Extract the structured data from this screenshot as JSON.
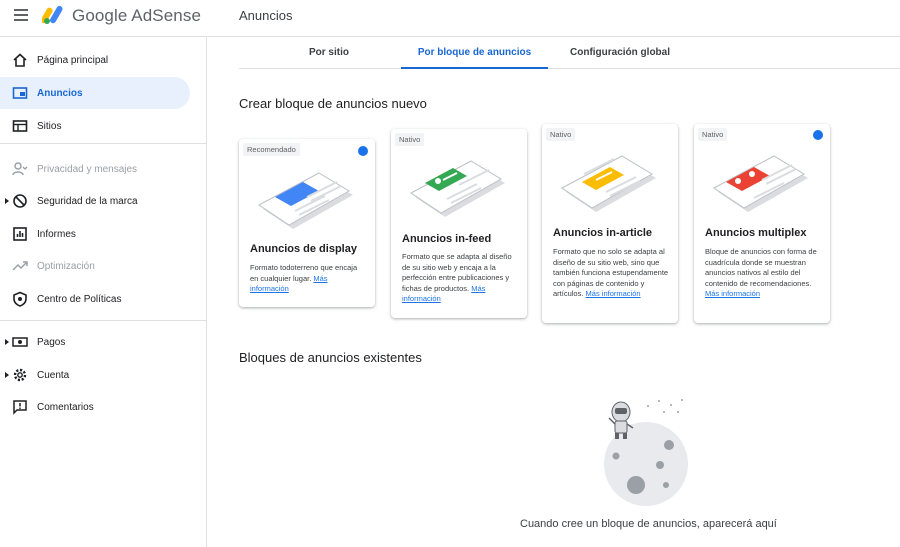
{
  "app": {
    "brand": "Google AdSense"
  },
  "header": {
    "title": "Anuncios"
  },
  "sidebar": {
    "items": [
      {
        "label": "Página principal",
        "icon": "home-icon"
      },
      {
        "label": "Anuncios",
        "icon": "ads-icon"
      },
      {
        "label": "Sitios",
        "icon": "sites-icon"
      },
      {
        "label": "Privacidad y mensajes",
        "icon": "privacy-icon"
      },
      {
        "label": "Seguridad de la marca",
        "icon": "block-icon"
      },
      {
        "label": "Informes",
        "icon": "reports-icon"
      },
      {
        "label": "Optimización",
        "icon": "optimization-icon"
      },
      {
        "label": "Centro de Políticas",
        "icon": "policy-icon"
      },
      {
        "label": "Pagos",
        "icon": "payments-icon"
      },
      {
        "label": "Cuenta",
        "icon": "gear-icon"
      },
      {
        "label": "Comentarios",
        "icon": "feedback-icon"
      }
    ]
  },
  "tabs": [
    {
      "label": "Por sitio"
    },
    {
      "label": "Por bloque de anuncios"
    },
    {
      "label": "Configuración global"
    }
  ],
  "create_section": {
    "title": "Crear bloque de anuncios nuevo"
  },
  "cards": [
    {
      "badge": "Recomendado",
      "title": "Anuncios de display",
      "desc": "Formato todoterreno que encaja en cualquier lugar.",
      "link": "Más información",
      "accent": "#4285f4"
    },
    {
      "badge": "Nativo",
      "title": "Anuncios in-feed",
      "desc": "Formato que se adapta al diseño de su sitio web y encaja a la perfección entre publicaciones y fichas de productos.",
      "link": "Más información",
      "accent": "#34a853"
    },
    {
      "badge": "Nativo",
      "title": "Anuncios in-article",
      "desc": "Formato que no solo se adapta al diseño de su sitio web, sino que también funciona estupendamente con páginas de contenido y artículos.",
      "link": "Más información",
      "accent": "#fbbc04"
    },
    {
      "badge": "Nativo",
      "title": "Anuncios multiplex",
      "desc": "Bloque de anuncios con forma de cuadrícula donde se muestran anuncios nativos al estilo del contenido de recomendaciones.",
      "link": "Más información",
      "accent": "#ea4335"
    }
  ],
  "existing_section": {
    "title": "Bloques de anuncios existentes"
  },
  "empty_state": {
    "text": "Cuando cree un bloque de anuncios, aparecerá aquí"
  },
  "colors": {
    "accent": "#1a73e8",
    "active_bg": "#e8f0fe"
  }
}
